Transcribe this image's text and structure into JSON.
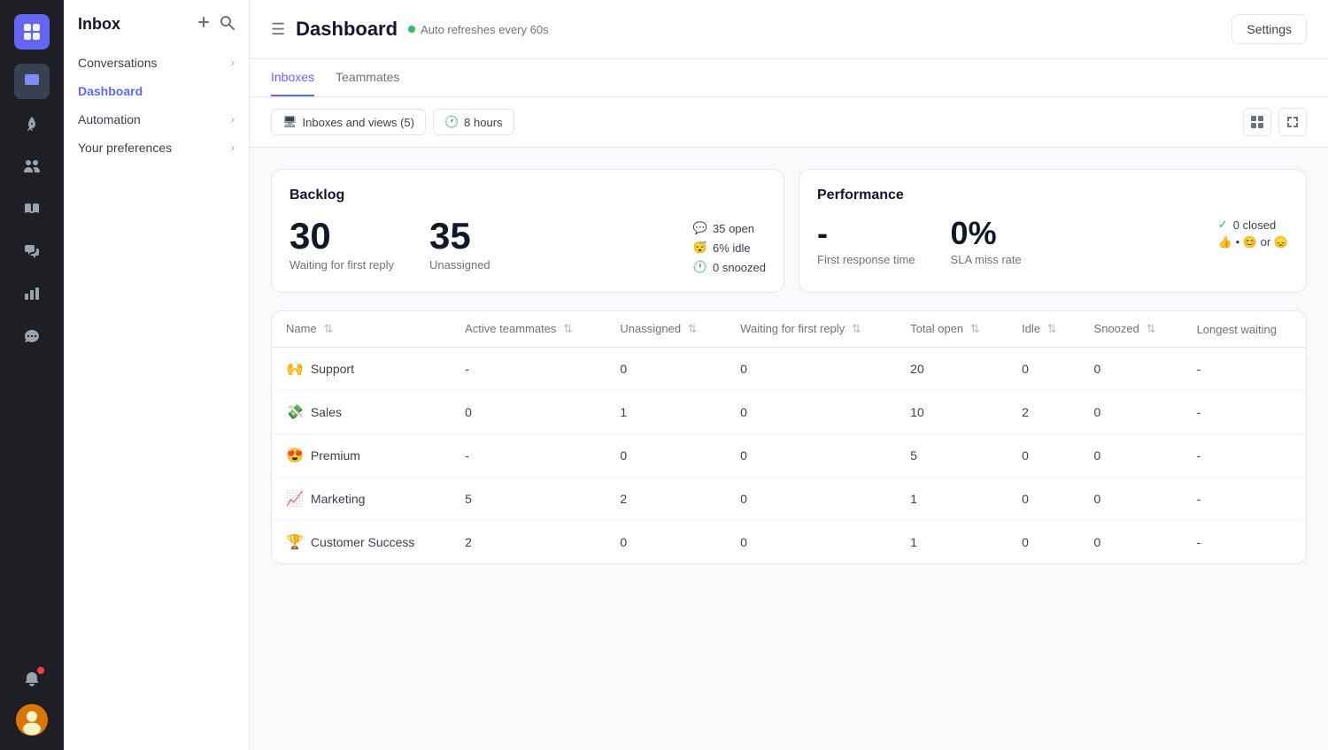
{
  "app": {
    "logo_icon": "≡",
    "title": "Inbox"
  },
  "sidebar": {
    "icons": [
      {
        "name": "inbox-icon",
        "symbol": "✉",
        "active": true
      },
      {
        "name": "rocket-icon",
        "symbol": "🚀",
        "active": false
      },
      {
        "name": "team-icon",
        "symbol": "👥",
        "active": false
      },
      {
        "name": "book-icon",
        "symbol": "📖",
        "active": false
      },
      {
        "name": "chat-icon",
        "symbol": "💬",
        "active": false
      },
      {
        "name": "chart-icon",
        "symbol": "📊",
        "active": false
      },
      {
        "name": "chat2-icon",
        "symbol": "🗨",
        "active": false
      },
      {
        "name": "grid-icon",
        "symbol": "⊞",
        "active": false
      }
    ]
  },
  "left_nav": {
    "title": "Inbox",
    "add_label": "+",
    "search_label": "🔍",
    "items": [
      {
        "label": "Conversations",
        "has_chevron": true,
        "active": false
      },
      {
        "label": "Dashboard",
        "has_chevron": false,
        "active": true
      },
      {
        "label": "Automation",
        "has_chevron": true,
        "active": false
      },
      {
        "label": "Your preferences",
        "has_chevron": true,
        "active": false
      }
    ]
  },
  "header": {
    "menu_icon": "☰",
    "title": "Dashboard",
    "auto_refresh_text": "Auto refreshes every 60s",
    "settings_label": "Settings"
  },
  "tabs": [
    {
      "label": "Inboxes",
      "active": true
    },
    {
      "label": "Teammates",
      "active": false
    }
  ],
  "filters": {
    "inboxes_label": "Inboxes and views (5)",
    "hours_label": "8 hours",
    "inboxes_icon": "🖥",
    "hours_icon": "🕐"
  },
  "backlog": {
    "title": "Backlog",
    "waiting_count": "30",
    "waiting_label": "Waiting for first reply",
    "unassigned_count": "35",
    "unassigned_label": "Unassigned",
    "details": [
      {
        "icon": "💬",
        "text": "35 open"
      },
      {
        "icon": "😴",
        "text": "6% idle"
      },
      {
        "icon": "🕐",
        "text": "0 snoozed"
      }
    ]
  },
  "performance": {
    "title": "Performance",
    "response_time": "-",
    "response_label": "First response time",
    "sla_rate": "0%",
    "sla_label": "SLA miss rate",
    "closed_count": "0 closed",
    "emoji_row": "👍 • 😊 or 😞"
  },
  "table": {
    "columns": [
      {
        "label": "Name",
        "sortable": true
      },
      {
        "label": "Active teammates",
        "sortable": true
      },
      {
        "label": "Unassigned",
        "sortable": true
      },
      {
        "label": "Waiting for first reply",
        "sortable": true
      },
      {
        "label": "Total open",
        "sortable": true
      },
      {
        "label": "Idle",
        "sortable": true
      },
      {
        "label": "Snoozed",
        "sortable": true
      },
      {
        "label": "Longest waiting",
        "sortable": false
      }
    ],
    "rows": [
      {
        "emoji": "🙌",
        "name": "Support",
        "active": "-",
        "unassigned": "0",
        "waiting": "0",
        "total_open": "20",
        "idle": "0",
        "snoozed": "0",
        "longest": "-"
      },
      {
        "emoji": "💸",
        "name": "Sales",
        "active": "0",
        "unassigned": "1",
        "waiting": "0",
        "total_open": "10",
        "idle": "2",
        "snoozed": "0",
        "longest": "-"
      },
      {
        "emoji": "😍",
        "name": "Premium",
        "active": "-",
        "unassigned": "0",
        "waiting": "0",
        "total_open": "5",
        "idle": "0",
        "snoozed": "0",
        "longest": "-"
      },
      {
        "emoji": "📈",
        "name": "Marketing",
        "active": "5",
        "unassigned": "2",
        "waiting": "0",
        "total_open": "1",
        "idle": "0",
        "snoozed": "0",
        "longest": "-"
      },
      {
        "emoji": "🏆",
        "name": "Customer Success",
        "active": "2",
        "unassigned": "0",
        "waiting": "0",
        "total_open": "1",
        "idle": "0",
        "snoozed": "0",
        "longest": "-"
      }
    ]
  }
}
